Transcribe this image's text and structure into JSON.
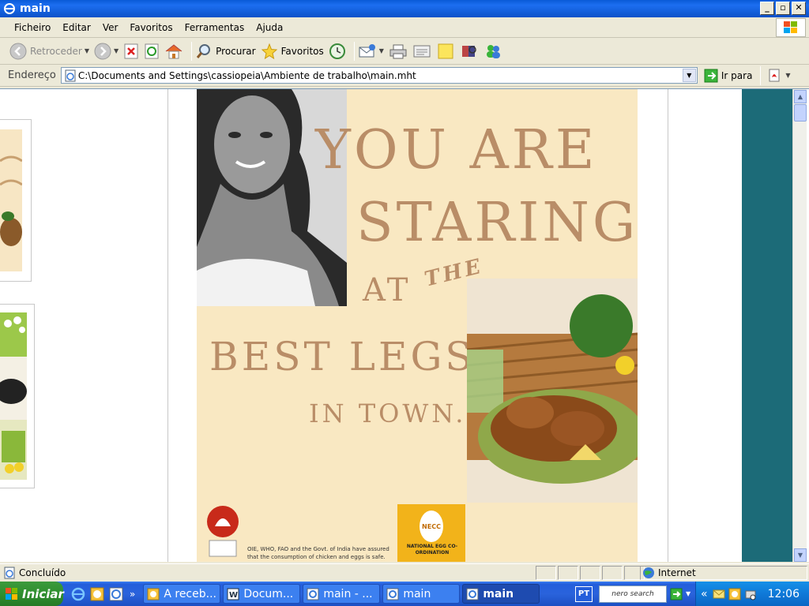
{
  "window": {
    "title": "main"
  },
  "menubar": {
    "items": [
      "Ficheiro",
      "Editar",
      "Ver",
      "Favoritos",
      "Ferramentas",
      "Ajuda"
    ]
  },
  "toolbar": {
    "back_label": "Retroceder",
    "search_label": "Procurar",
    "favorites_label": "Favoritos"
  },
  "address": {
    "label": "Endereço",
    "value": "C:\\Documents and Settings\\cassiopeia\\Ambiente de trabalho\\main.mht",
    "go_label": "Ir para"
  },
  "ad": {
    "line1": "YOU ARE",
    "line2": "STARING",
    "line3": "AT",
    "line3b": "THE",
    "line4": "BEST LEGS",
    "line5": "IN TOWN.",
    "disclaimer": "OIE, WHO, FAO and the Govt. of India have assured that the consumption of chicken and eggs is safe.",
    "necc_badge": "NECC",
    "necc_label": "NATIONAL EGG CO-ORDINATION"
  },
  "status": {
    "text": "Concluído",
    "zone": "Internet"
  },
  "taskbar": {
    "start_label": "Iniciar",
    "tasks": [
      "A receb...",
      "Docum...",
      "main - ...",
      "main",
      "main"
    ],
    "lang": "PT",
    "nero_label": "nero search",
    "time": "12:06"
  },
  "colors": {
    "titlebar": "#0c52c8",
    "ad_bg": "#f9e8c2",
    "ad_text": "#b98d67",
    "teal": "#1c6b78"
  }
}
